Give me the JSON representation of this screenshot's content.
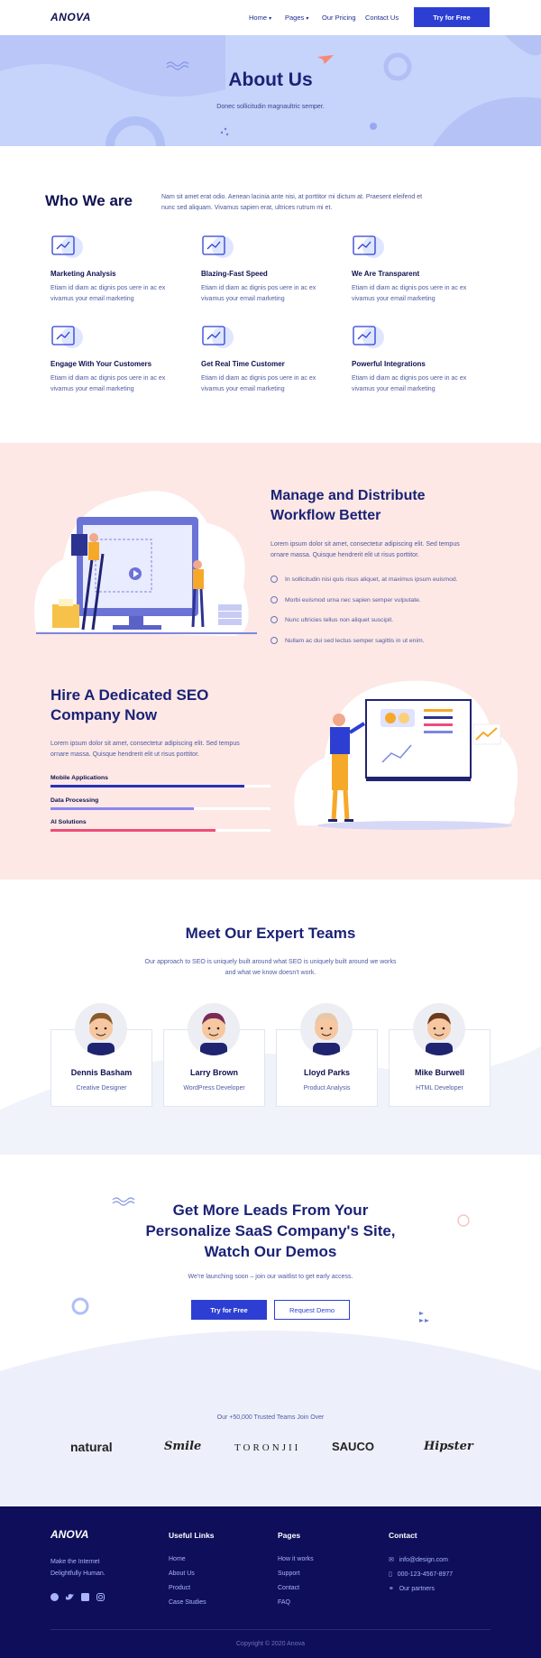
{
  "nav": {
    "logo": "ANOVA",
    "links": [
      "Home",
      "Pages",
      "Our Pricing",
      "Contact Us"
    ],
    "cta": "Try for Free"
  },
  "hero": {
    "title": "About Us",
    "subtitle": "Donec sollicitudin magnaultric semper."
  },
  "who": {
    "title": "Who We are",
    "text": "Nam sit amet erat odio. Aenean lacinia ante nisi, at porttitor mi dictum at. Praesent eleifend et nunc sed aliquam. Vivamus sapien erat, ultrices rutrum mi et.",
    "features": [
      {
        "title": "Marketing Analysis",
        "desc": "Etiam id diam ac dignis pos uere in ac ex vivamus your email marketing",
        "icon": "analysis-board-icon"
      },
      {
        "title": "Blazing-Fast Speed",
        "desc": "Etiam id diam ac dignis pos uere in ac ex vivamus your email marketing",
        "icon": "speedometer-icon"
      },
      {
        "title": "We Are Transparent",
        "desc": "Etiam id diam ac dignis pos uere in ac ex vivamus your email marketing",
        "icon": "overlapping-circles-icon"
      },
      {
        "title": "Engage With Your Customers",
        "desc": "Etiam id diam ac dignis pos uere in ac ex vivamus your email marketing",
        "icon": "customer-icon"
      },
      {
        "title": "Get Real Time Customer",
        "desc": "Etiam id diam ac dignis pos uere in ac ex vivamus your email marketing",
        "icon": "clock-icon"
      },
      {
        "title": "Powerful Integrations",
        "desc": "Etiam id diam ac dignis pos uere in ac ex vivamus your email marketing",
        "icon": "gear-browser-icon"
      }
    ]
  },
  "workflow": {
    "title_line1": "Manage and Distribute",
    "title_line2": "Workflow Better",
    "text": "Lorem ipsum dolor sit amet, consectetur adipiscing elit. Sed tempus ornare massa. Quisque hendrerit elit ut risus porttitor.",
    "list": [
      "In sollicitudin nisi quis risus aliquet, at maximus ipsum euismod.",
      "Morbi euismod urna nec sapien semper vulputate.",
      "Nunc ultricies tellus non aliquet suscipit.",
      "Nullam ac dui sed lectus semper sagittis in ut enim."
    ]
  },
  "seo": {
    "title_line1": "Hire A Dedicated SEO",
    "title_line2": "Company Now",
    "text": "Lorem ipsum dolor sit amet, consectetur adipiscing elit. Sed tempus ornare massa. Quisque hendrerit elit ut risus porttitor.",
    "skills": [
      {
        "label": "Mobile Applications",
        "value": 0.88,
        "color": "#2432b8"
      },
      {
        "label": "Data Processing",
        "value": 0.65,
        "color": "#8b86f0"
      },
      {
        "label": "AI Solutions",
        "value": 0.75,
        "color": "#ee4d78"
      }
    ]
  },
  "team": {
    "title": "Meet Our Expert Teams",
    "subtitle_line1": "Our approach to SEO is uniquely built around what SEO is uniquely built around we works",
    "subtitle_line2": "and what we know doesn't work.",
    "members": [
      {
        "name": "Dennis Basham",
        "role": "Creative Designer"
      },
      {
        "name": "Larry Brown",
        "role": "WordPress Developer"
      },
      {
        "name": "Lloyd Parks",
        "role": "Product Analysis"
      },
      {
        "name": "Mike Burwell",
        "role": "HTML Developer"
      }
    ]
  },
  "cta": {
    "line1": "Get More Leads From Your",
    "line2": "Personalize SaaS Company's Site,",
    "line3": "Watch Our Demos",
    "sub": "We're launching soon – join our waitlist to get early access.",
    "primary": "Try for Free",
    "secondary": "Request Demo"
  },
  "trusted": {
    "text": "Our +50,000 Trusted Teams Join Over",
    "brands": [
      "natural",
      "Smile",
      "TORONJII",
      "SAUCO",
      "Hipster"
    ]
  },
  "footer": {
    "logo": "ANOVA",
    "tagline_line1": "Make the Internet",
    "tagline_line2": "Delightfully Human.",
    "useful_title": "Useful Links",
    "useful": [
      "Home",
      "About Us",
      "Product",
      "Case Studies"
    ],
    "pages_title": "Pages",
    "pages": [
      "How it works",
      "Support",
      "Contact",
      "FAQ"
    ],
    "contact_title": "Contact",
    "email": "info@design.com",
    "phone": "000-123-4567-8977",
    "partners": "Our partners",
    "copyright": "Copyright © 2020 Anova"
  },
  "colors": {
    "accent": "#2d3fd3",
    "navy": "#0f1150",
    "hero": "#c6d3fb",
    "pink": "#fde8e5",
    "footer": "#0f0e5a"
  }
}
